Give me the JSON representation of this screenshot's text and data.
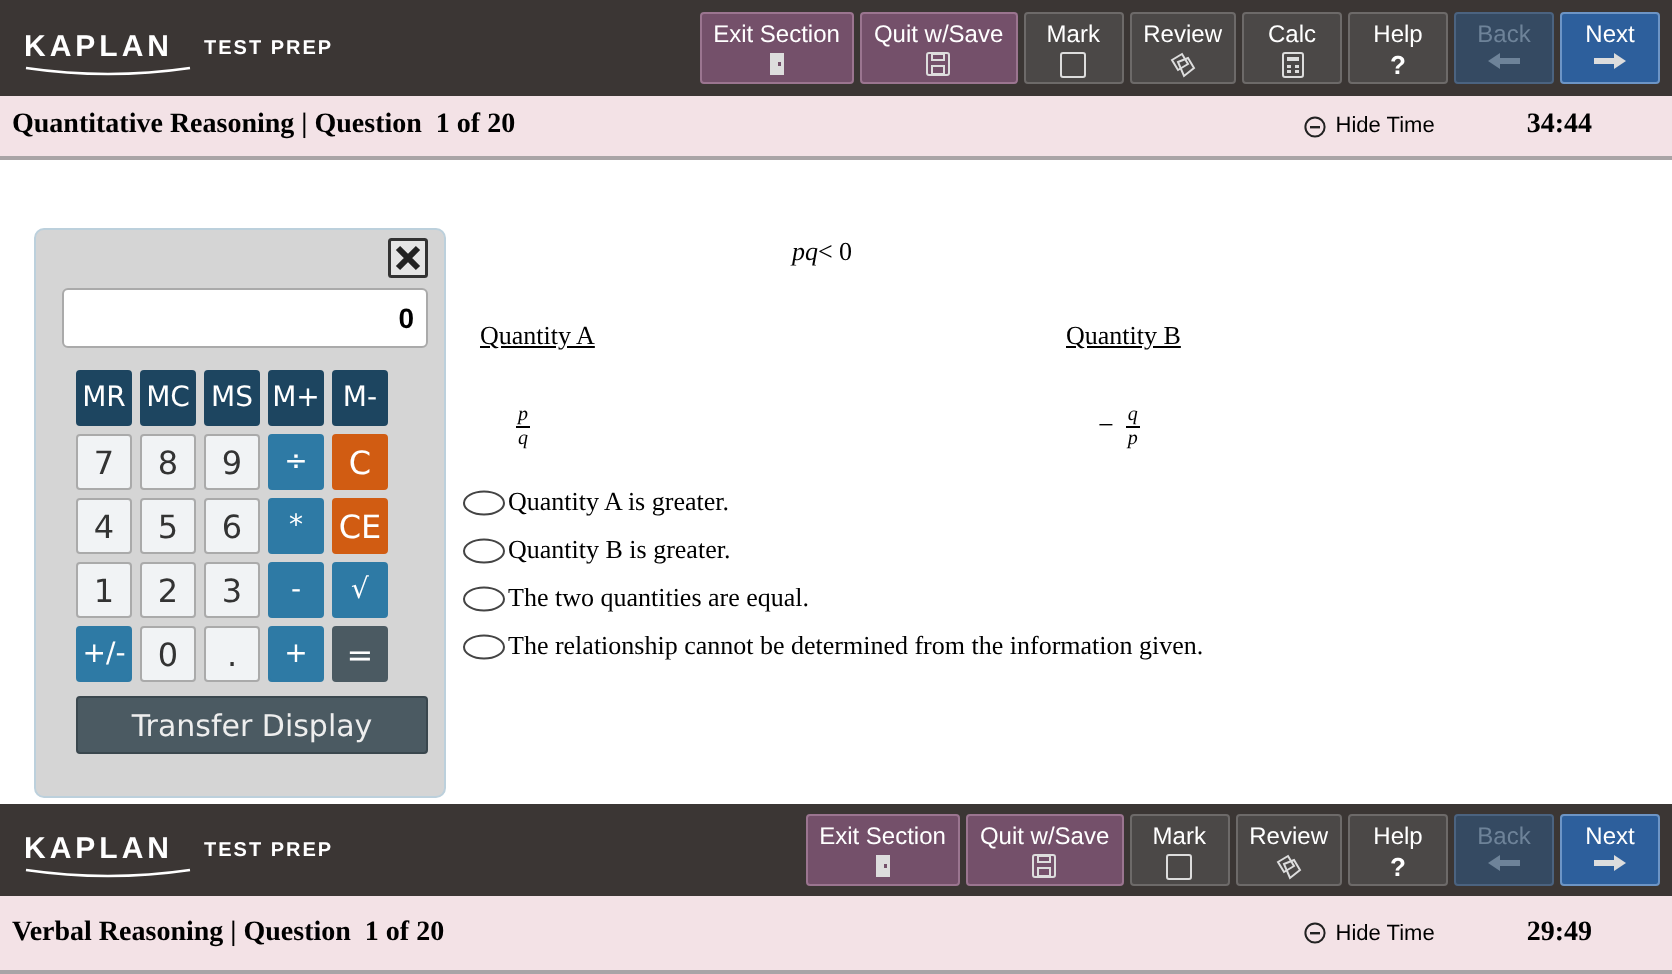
{
  "top_bar": {
    "logo": "KAPLAN",
    "logo_tagline": "TEST PREP",
    "buttons": [
      {
        "label": "Exit Section",
        "kind": "exit",
        "disabled": false
      },
      {
        "label": "Quit w/Save",
        "kind": "save",
        "disabled": false
      },
      {
        "label": "Mark",
        "kind": "mark",
        "disabled": false
      },
      {
        "label": "Review",
        "kind": "review",
        "disabled": false
      },
      {
        "label": "Calc",
        "kind": "calc",
        "disabled": false
      },
      {
        "label": "Help",
        "kind": "help",
        "glyph": "?",
        "disabled": false
      },
      {
        "label": "Back",
        "kind": "back",
        "disabled": true
      },
      {
        "label": "Next",
        "kind": "next",
        "disabled": false
      }
    ],
    "status": {
      "section": "Quantitative Reasoning | Question  1 of 20",
      "hide_time": "Hide Time",
      "timer": "34:44"
    }
  },
  "calculator": {
    "display": "0",
    "keys": [
      [
        {
          "label": "MR",
          "kind": "memory"
        },
        {
          "label": "MC",
          "kind": "memory"
        },
        {
          "label": "MS",
          "kind": "memory"
        },
        {
          "label": "M+",
          "kind": "memory"
        },
        {
          "label": "M-",
          "kind": "memory"
        }
      ],
      [
        {
          "label": "7",
          "kind": "digit"
        },
        {
          "label": "8",
          "kind": "digit"
        },
        {
          "label": "9",
          "kind": "digit"
        },
        {
          "label": "÷",
          "kind": "operator"
        },
        {
          "label": "C",
          "kind": "clear"
        }
      ],
      [
        {
          "label": "4",
          "kind": "digit"
        },
        {
          "label": "5",
          "kind": "digit"
        },
        {
          "label": "6",
          "kind": "digit"
        },
        {
          "label": "*",
          "kind": "operator"
        },
        {
          "label": "CE",
          "kind": "clear"
        }
      ],
      [
        {
          "label": "1",
          "kind": "digit"
        },
        {
          "label": "2",
          "kind": "digit"
        },
        {
          "label": "3",
          "kind": "digit"
        },
        {
          "label": "-",
          "kind": "operator"
        },
        {
          "label": "√",
          "kind": "operator"
        }
      ],
      [
        {
          "label": "+/-",
          "kind": "operator"
        },
        {
          "label": "0",
          "kind": "digit"
        },
        {
          "label": ".",
          "kind": "digit"
        },
        {
          "label": "+",
          "kind": "operator"
        },
        {
          "label": "=",
          "kind": "equals"
        }
      ]
    ],
    "transfer": "Transfer Display"
  },
  "question": {
    "condition": "*pq*< 0",
    "quantity_a": {
      "heading": "Quantity A",
      "numerator": "p",
      "denominator": "q"
    },
    "quantity_b": {
      "heading": "Quantity B",
      "sign": "−",
      "numerator": "q",
      "denominator": "p"
    },
    "options": [
      {
        "text": "Quantity A is greater.",
        "selected": false
      },
      {
        "text": "Quantity B is greater.",
        "selected": false
      },
      {
        "text": "The two quantities are equal.",
        "selected": false
      },
      {
        "text": "The relationship cannot be determined from the information given.",
        "selected": false
      }
    ]
  },
  "bottom_bar": {
    "logo": "KAPLAN",
    "logo_tagline": "TEST PREP",
    "buttons": [
      {
        "label": "Exit Section",
        "kind": "exit",
        "disabled": false
      },
      {
        "label": "Quit w/Save",
        "kind": "save",
        "disabled": false
      },
      {
        "label": "Mark",
        "kind": "mark",
        "disabled": false
      },
      {
        "label": "Review",
        "kind": "review",
        "disabled": false
      },
      {
        "label": "Help",
        "kind": "help",
        "glyph": "?",
        "disabled": false
      },
      {
        "label": "Back",
        "kind": "back",
        "disabled": true
      },
      {
        "label": "Next",
        "kind": "next",
        "disabled": false
      }
    ],
    "status": {
      "section": "Verbal Reasoning | Question  1 of 20",
      "hide_time": "Hide Time",
      "timer": "29:49"
    }
  }
}
